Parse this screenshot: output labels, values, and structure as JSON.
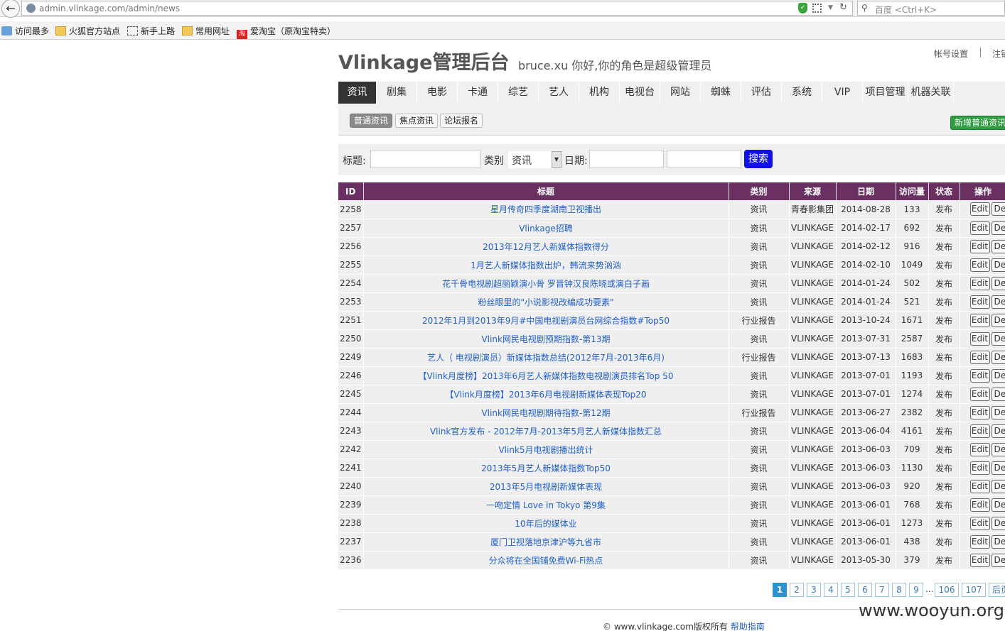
{
  "browser": {
    "url": "admin.vlinkage.com/admin/news",
    "search_placeholder": "百度 <Ctrl+K>",
    "bookmarks": [
      "访问最多",
      "火狐官方站点",
      "新手上路",
      "常用网址",
      "爱淘宝（原淘宝特卖）"
    ]
  },
  "header": {
    "title": "Vlinkage管理后台",
    "welcome": "bruce.xu  你好,你的角色是超级管理员",
    "account_settings": "帐号设置",
    "logout": "注销"
  },
  "nav": [
    "资讯",
    "剧集",
    "电影",
    "卡通",
    "综艺",
    "艺人",
    "机构",
    "电视台",
    "网站",
    "蜘蛛",
    "评估",
    "系统",
    "VIP",
    "项目管理",
    "机器关联"
  ],
  "subnav": [
    "普通资讯",
    "焦点资讯",
    "论坛报名"
  ],
  "add_button": "新增普通资讯",
  "filter": {
    "title_label": "标题:",
    "category_label": "类别",
    "category_value": "资讯",
    "date_label": "日期:",
    "search_button": "搜索"
  },
  "table": {
    "columns": [
      "ID",
      "标题",
      "类别",
      "来源",
      "日期",
      "访问量",
      "状态",
      "操作"
    ],
    "edit_label": "Edit",
    "delete_label": "Del",
    "rows": [
      [
        "2258",
        "星月传奇四季度湖南卫视播出",
        "资讯",
        "青春影集团",
        "2014-08-28",
        "133",
        "发布"
      ],
      [
        "2257",
        "Vlinkage招聘",
        "资讯",
        "VLINKAGE",
        "2014-02-17",
        "692",
        "发布"
      ],
      [
        "2256",
        "2013年12月艺人新媒体指数得分",
        "资讯",
        "VLINKAGE",
        "2014-02-12",
        "916",
        "发布"
      ],
      [
        "2255",
        "1月艺人新媒体指数出炉，韩流来势汹汹",
        "资讯",
        "VLINKAGE",
        "2014-02-10",
        "1049",
        "发布"
      ],
      [
        "2254",
        "花千骨电视剧超丽颖演小骨 罗晋钟汉良陈晓或演白子画",
        "资讯",
        "VLINKAGE",
        "2014-01-24",
        "502",
        "发布"
      ],
      [
        "2253",
        "粉丝眼里的\"小说影视改编成功要素\"",
        "资讯",
        "VLINKAGE",
        "2014-01-24",
        "521",
        "发布"
      ],
      [
        "2251",
        "2012年1月到2013年9月#中国电视剧演员台网综合指数#Top50",
        "行业报告",
        "VLINKAGE",
        "2013-10-24",
        "1671",
        "发布"
      ],
      [
        "2250",
        "Vlink网民电视剧预期指数-第13期",
        "资讯",
        "VLINKAGE",
        "2013-07-31",
        "2587",
        "发布"
      ],
      [
        "2249",
        "艺人（ 电视剧演员）新媒体指数总结(2012年7月-2013年6月)",
        "行业报告",
        "VLINKAGE",
        "2013-07-13",
        "1683",
        "发布"
      ],
      [
        "2246",
        "【Vlink月度榜】2013年6月艺人新媒体指数电视剧演员排名Top 50",
        "资讯",
        "VLINKAGE",
        "2013-07-01",
        "1193",
        "发布"
      ],
      [
        "2245",
        "【Vlink月度榜】2013年6月电视剧新媒体表现Top20",
        "资讯",
        "VLINKAGE",
        "2013-07-01",
        "1274",
        "发布"
      ],
      [
        "2244",
        "Vlink网民电视剧期待指数-第12期",
        "行业报告",
        "VLINKAGE",
        "2013-06-27",
        "2382",
        "发布"
      ],
      [
        "2243",
        "Vlink官方发布 - 2012年7月-2013年5月艺人新媒体指数汇总",
        "资讯",
        "VLINKAGE",
        "2013-06-04",
        "4161",
        "发布"
      ],
      [
        "2242",
        "Vlink5月电视剧播出统计",
        "资讯",
        "VLINKAGE",
        "2013-06-03",
        "709",
        "发布"
      ],
      [
        "2241",
        "2013年5月艺人新媒体指数Top50",
        "资讯",
        "VLINKAGE",
        "2013-06-03",
        "1130",
        "发布"
      ],
      [
        "2240",
        "2013年5月电视剧新媒体表现",
        "资讯",
        "VLINKAGE",
        "2013-06-03",
        "920",
        "发布"
      ],
      [
        "2239",
        "一吻定情 Love in Tokyo 第9集",
        "资讯",
        "VLINKAGE",
        "2013-06-01",
        "768",
        "发布"
      ],
      [
        "2238",
        "10年后的媒体业",
        "资讯",
        "VLINKAGE",
        "2013-06-01",
        "1273",
        "发布"
      ],
      [
        "2237",
        "厦门卫视落地京津沪等九省市",
        "资讯",
        "VLINKAGE",
        "2013-06-01",
        "438",
        "发布"
      ],
      [
        "2236",
        "分众将在全国铺免费Wi-Fi热点",
        "资讯",
        "VLINKAGE",
        "2013-05-30",
        "379",
        "发布"
      ]
    ]
  },
  "pager": {
    "pages": [
      "1",
      "2",
      "3",
      "4",
      "5",
      "6",
      "7",
      "8",
      "9"
    ],
    "ellipsis": "...",
    "tail": [
      "106",
      "107",
      "后页"
    ],
    "current": "1"
  },
  "footer": {
    "copyright": "© www.vlinkage.com版权所有",
    "help": "帮助指南"
  },
  "watermark": "www.wooyun.org"
}
